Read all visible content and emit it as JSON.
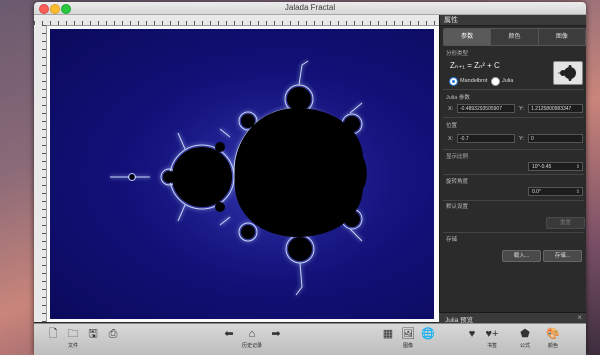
{
  "window": {
    "title": "Jalada Fractal"
  },
  "panel": {
    "title": "属性",
    "tabs": [
      "参数",
      "颜色",
      "图像"
    ],
    "active_tab": 0,
    "formula_section": "分形类型",
    "formula": "Zₙ₊₁ = Zₙ² + C",
    "radio_mandelbrot": "Mandelbrot",
    "radio_julia": "Julia",
    "julia_section": "Julia 参数",
    "julia_x_label": "X:",
    "julia_x": "-0.4893293505907",
    "julia_y_label": "Y:",
    "julia_y": "1.2125800983347",
    "position_section": "位置",
    "pos_x_label": "X:",
    "pos_x": "-0.7",
    "pos_y_label": "Y:",
    "pos_y": "0",
    "scale_section": "显示比例",
    "scale_value": "10^-0.45",
    "rotation_section": "旋转角度",
    "rotation_value": "0.0°",
    "defaults_section": "默认设置",
    "reset_button": "重置",
    "file_section": "存储",
    "load_button": "载入...",
    "save_button": "存储..."
  },
  "julia_preview": {
    "title": "Julia 预览"
  },
  "toolbar": {
    "new_label": "",
    "open_label": "文件",
    "save_label": "",
    "print_label": "",
    "back_label": "",
    "home_label": "历史记录",
    "forward_label": "",
    "grid_label": "",
    "image_label": "图像",
    "globe_label": "",
    "fav_label": "",
    "fav_add_label": "书签",
    "formula_label": "公式",
    "color_label": "颜色"
  }
}
